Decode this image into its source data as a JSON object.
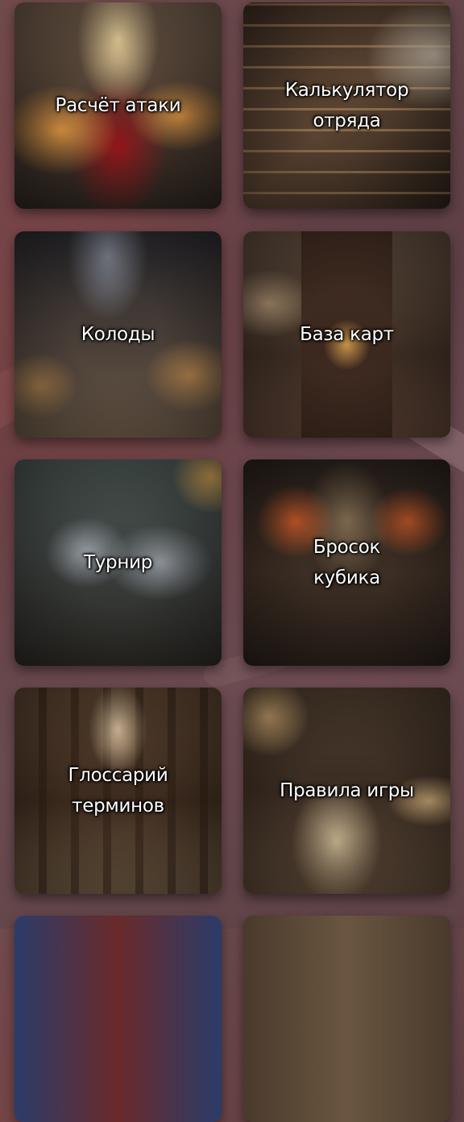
{
  "menu": {
    "tiles": [
      {
        "label": "Расчёт атаки"
      },
      {
        "label": "Калькулятор\nотряда"
      },
      {
        "label": "Колоды"
      },
      {
        "label": "База карт"
      },
      {
        "label": "Турнир"
      },
      {
        "label": "Бросок\nкубика"
      },
      {
        "label": "Глоссарий\nтерминов"
      },
      {
        "label": "Правила игры"
      }
    ]
  }
}
